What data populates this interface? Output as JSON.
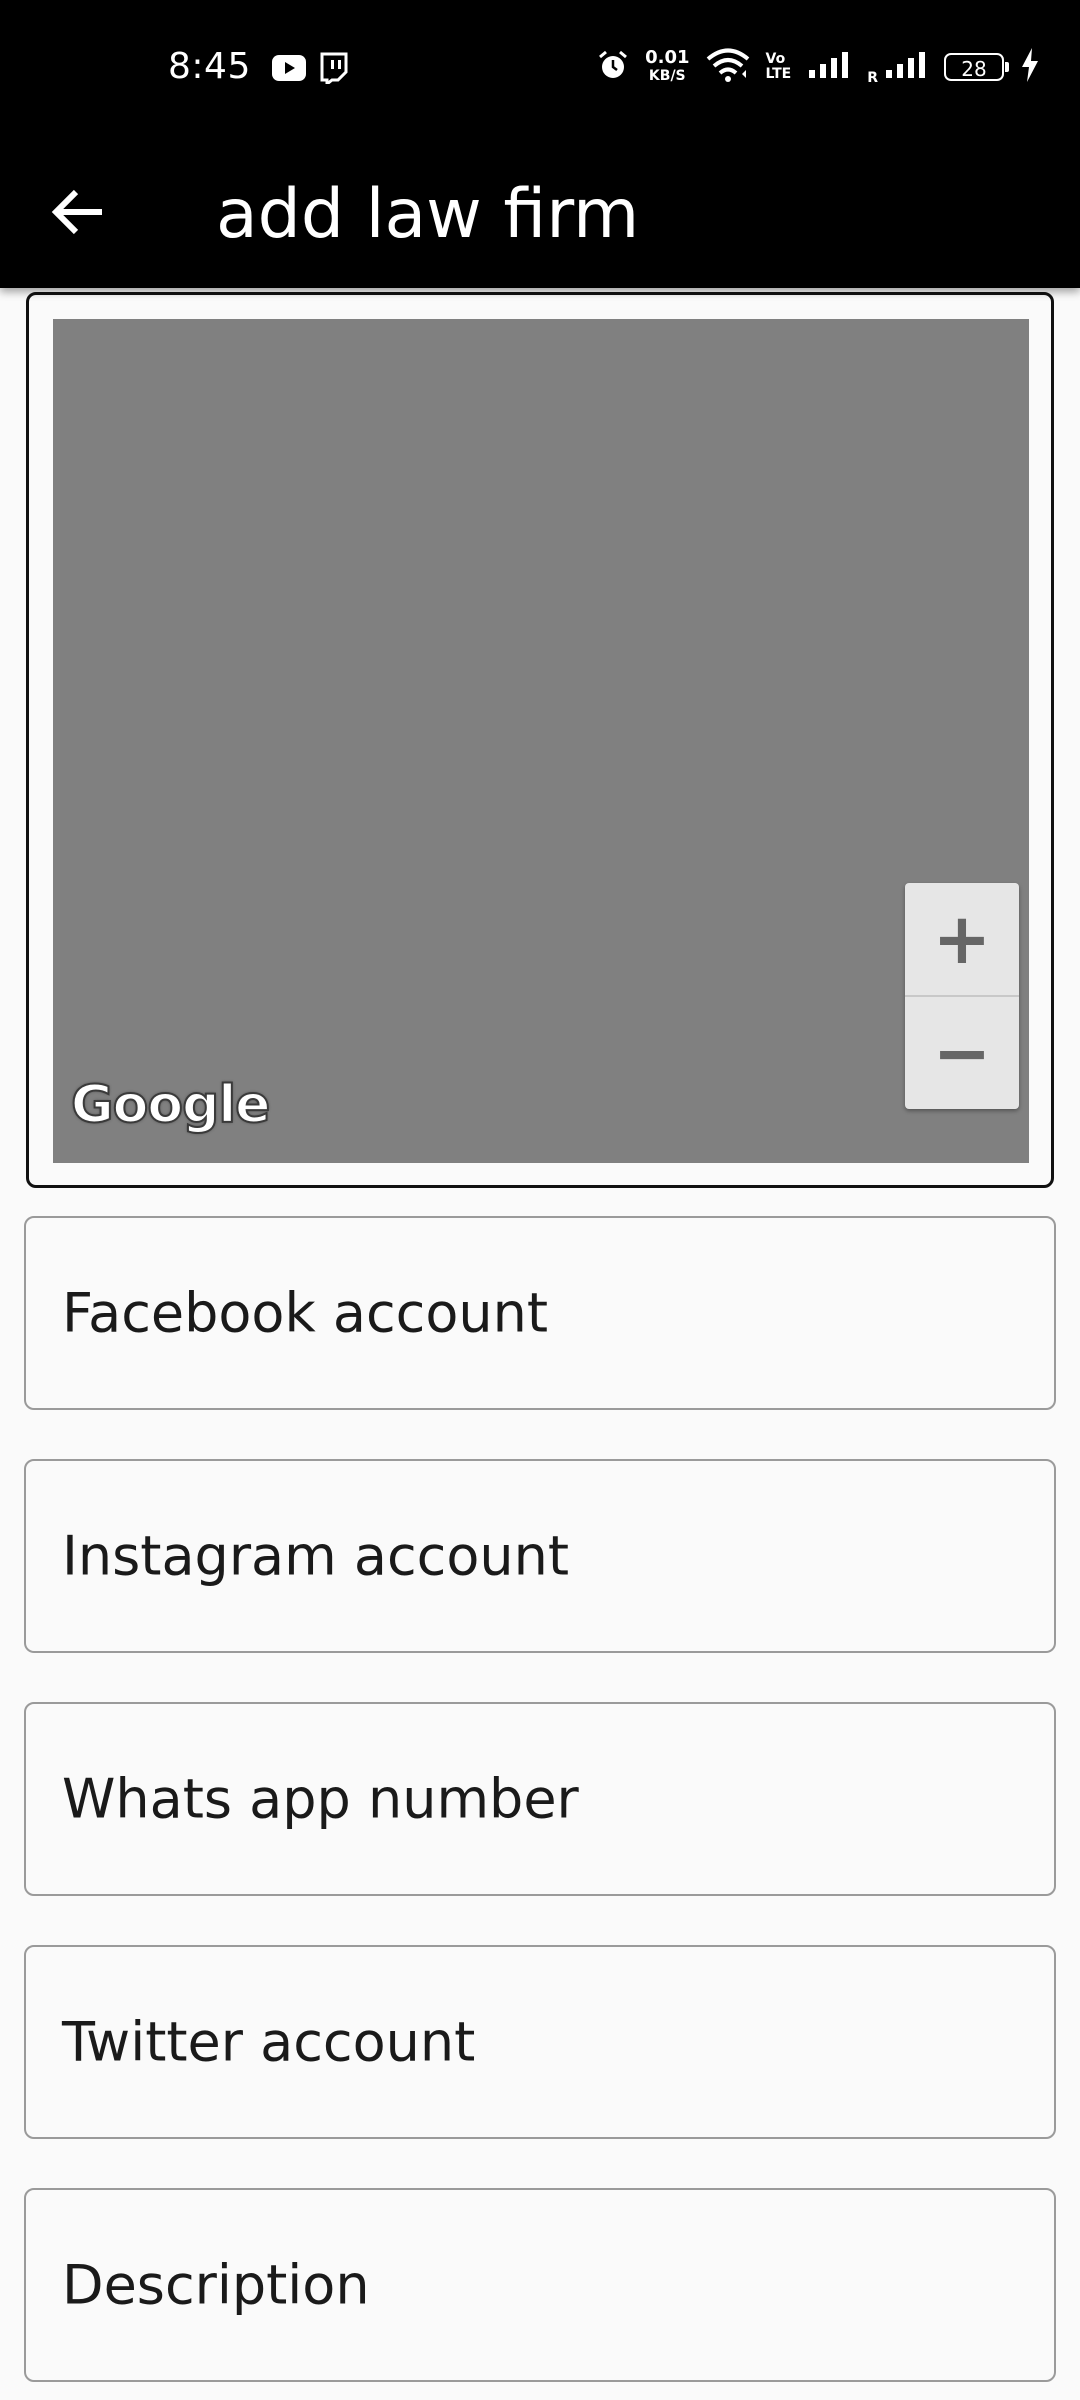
{
  "status_bar": {
    "time": "8:45",
    "net_speed_value": "0.01",
    "net_speed_unit": "KB/S",
    "volte_top": "Vo",
    "volte_bottom": "LTE",
    "roaming": "R",
    "battery": "28",
    "left_icons": [
      "youtube-icon",
      "twitch-icon"
    ],
    "right_icons": [
      "alarm-icon",
      "wifi-icon",
      "signal-icon",
      "signal-icon",
      "charging-icon"
    ]
  },
  "app_bar": {
    "title": "add law firm",
    "back_icon": "arrow-left-icon"
  },
  "map": {
    "zoom_in_label": "+",
    "zoom_out_label": "−",
    "logo_text": "Google",
    "background_color": "#808080"
  },
  "form": {
    "fields": [
      {
        "label": "Facebook account"
      },
      {
        "label": "Instagram account"
      },
      {
        "label": "Whats app number"
      },
      {
        "label": "Twitter account"
      },
      {
        "label": "Description"
      }
    ]
  },
  "colors": {
    "app_bar": "#000000",
    "background": "#fafafa",
    "field_border": "#9a9a9a"
  }
}
